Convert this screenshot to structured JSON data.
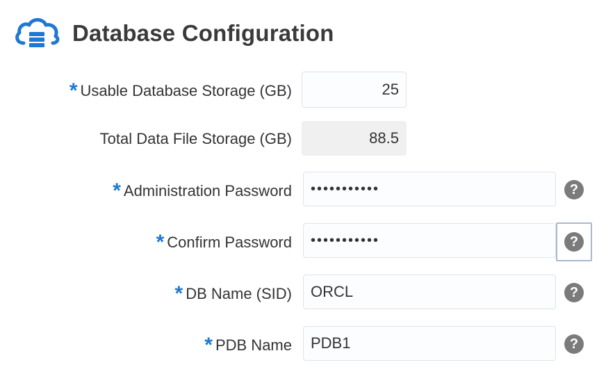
{
  "section": {
    "title": "Database Configuration",
    "icon": "cloud-database-icon",
    "accent_color": "#1f78d1"
  },
  "fields": {
    "usable_storage": {
      "label": "Usable Database Storage (GB)",
      "value": "25",
      "required": true
    },
    "total_storage": {
      "label": "Total Data File Storage (GB)",
      "value": "88.5",
      "required": false,
      "readonly": true
    },
    "admin_password": {
      "label": "Administration Password",
      "value": "•••••••••••",
      "required": true
    },
    "confirm_password": {
      "label": "Confirm Password",
      "value": "•••••••••••",
      "required": true
    },
    "db_name": {
      "label": "DB Name (SID)",
      "value": "ORCL",
      "required": true
    },
    "pdb_name": {
      "label": "PDB Name",
      "value": "PDB1",
      "required": true
    }
  },
  "required_marker": "*",
  "help_glyph": "?"
}
